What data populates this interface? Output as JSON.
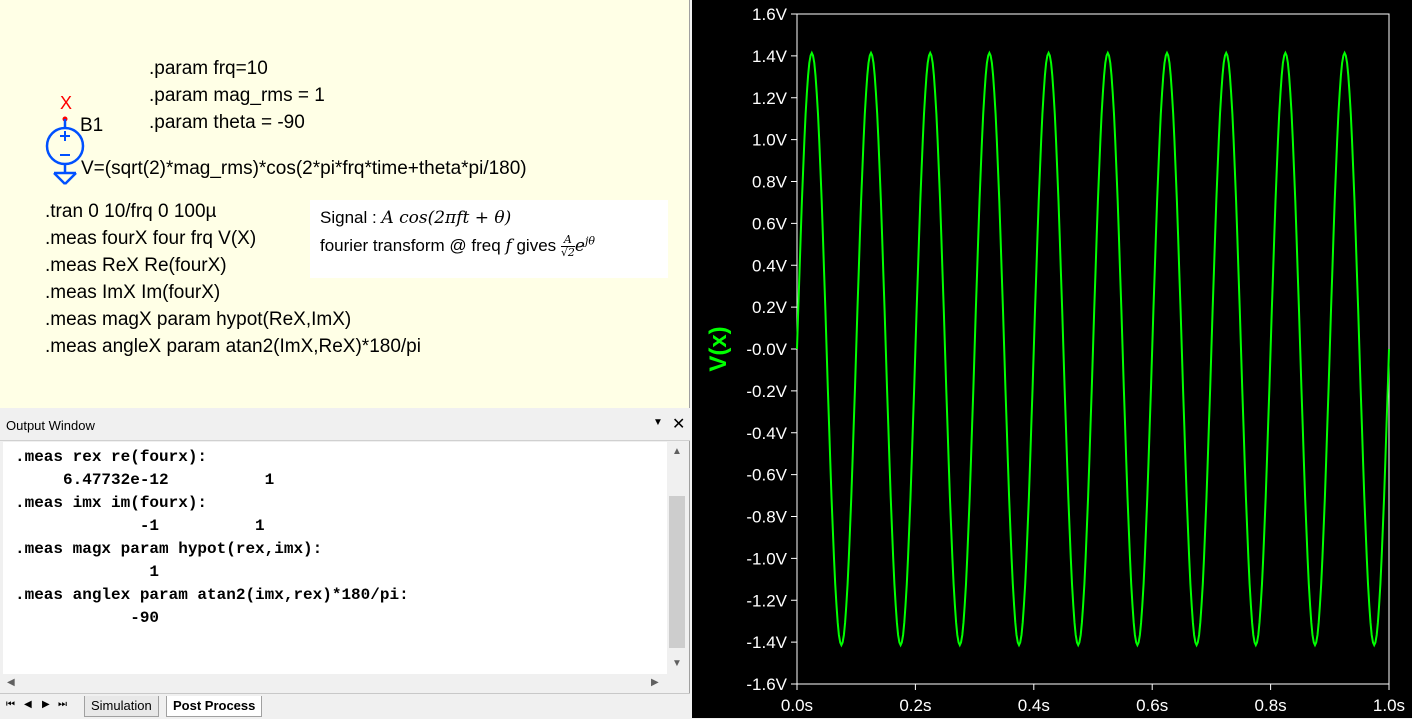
{
  "schematic": {
    "params": [
      ".param frq=10",
      ".param mag_rms = 1",
      ".param theta = -90"
    ],
    "node_label": "X",
    "source_name": "B1",
    "source_expr": "V=(sqrt(2)*mag_rms)*cos(2*pi*frq*time+theta*pi/180)",
    "directives": [
      ".tran 0 10/frq 0 100µ",
      ".meas fourX four frq V(X)",
      ".meas ReX Re(fourX)",
      ".meas ImX Im(fourX)",
      ".meas magX param hypot(ReX,ImX)",
      ".meas angleX param atan2(ImX,ReX)*180/pi"
    ],
    "note": {
      "signal_label": "Signal : ",
      "signal_formula": "A cos(2πft + θ)",
      "line2_text": "fourier transform @ freq ",
      "line2_var": "f",
      "line2_gives": " gives ",
      "frac_num": "A",
      "frac_den": "√2",
      "exp_base": "e",
      "exp_power": "jθ"
    }
  },
  "output_window": {
    "title": "Output Window",
    "chevron_icon": "chevron-down-icon",
    "close_icon": "close-icon",
    "lines": [
      ".meas rex re(fourx):",
      "     6.47732e-12          1",
      ".meas imx im(fourx):",
      "             -1          1",
      ".meas magx param hypot(rex,imx):",
      "              1",
      ".meas anglex param atan2(imx,rex)*180/pi:",
      "            -90"
    ],
    "tabs": [
      "Simulation",
      "Post Process"
    ],
    "active_tab": "Post Process"
  },
  "plot": {
    "trace_color": "#00ff00",
    "axis_color": "#ffffff"
  },
  "chart_data": {
    "type": "line",
    "title": "",
    "xlabel": "",
    "ylabel": "V(x)",
    "xlim": [
      0.0,
      1.0
    ],
    "ylim": [
      -1.6,
      1.6
    ],
    "x_ticks": [
      "0.0s",
      "0.2s",
      "0.4s",
      "0.6s",
      "0.8s",
      "1.0s"
    ],
    "y_ticks": [
      "1.6V",
      "1.4V",
      "1.2V",
      "1.0V",
      "0.8V",
      "0.6V",
      "0.4V",
      "0.2V",
      "-0.0V",
      "-0.2V",
      "-0.4V",
      "-0.6V",
      "-0.8V",
      "-1.0V",
      "-1.2V",
      "-1.4V",
      "-1.6V"
    ],
    "series": [
      {
        "name": "V(x)",
        "color": "#00ff00",
        "x": [
          0.0,
          0.025,
          0.05,
          0.075,
          0.1,
          0.125,
          0.15,
          0.175,
          0.2,
          0.225,
          0.25,
          0.275,
          0.3,
          0.325,
          0.35,
          0.375,
          0.4,
          0.425,
          0.45,
          0.475,
          0.5,
          0.525,
          0.55,
          0.575,
          0.6,
          0.625,
          0.65,
          0.675,
          0.7,
          0.725,
          0.75,
          0.775,
          0.8,
          0.825,
          0.85,
          0.875,
          0.9,
          0.925,
          0.95,
          0.975,
          1.0
        ],
        "y": [
          0.0,
          1.414,
          0.0,
          -1.414,
          0.0,
          1.414,
          0.0,
          -1.414,
          0.0,
          1.414,
          0.0,
          -1.414,
          0.0,
          1.414,
          0.0,
          -1.414,
          0.0,
          1.414,
          0.0,
          -1.414,
          0.0,
          1.414,
          0.0,
          -1.414,
          0.0,
          1.414,
          0.0,
          -1.414,
          0.0,
          1.414,
          0.0,
          -1.414,
          0.0,
          1.414,
          0.0,
          -1.414,
          0.0,
          1.414,
          0.0,
          -1.414,
          0.0
        ]
      }
    ]
  }
}
